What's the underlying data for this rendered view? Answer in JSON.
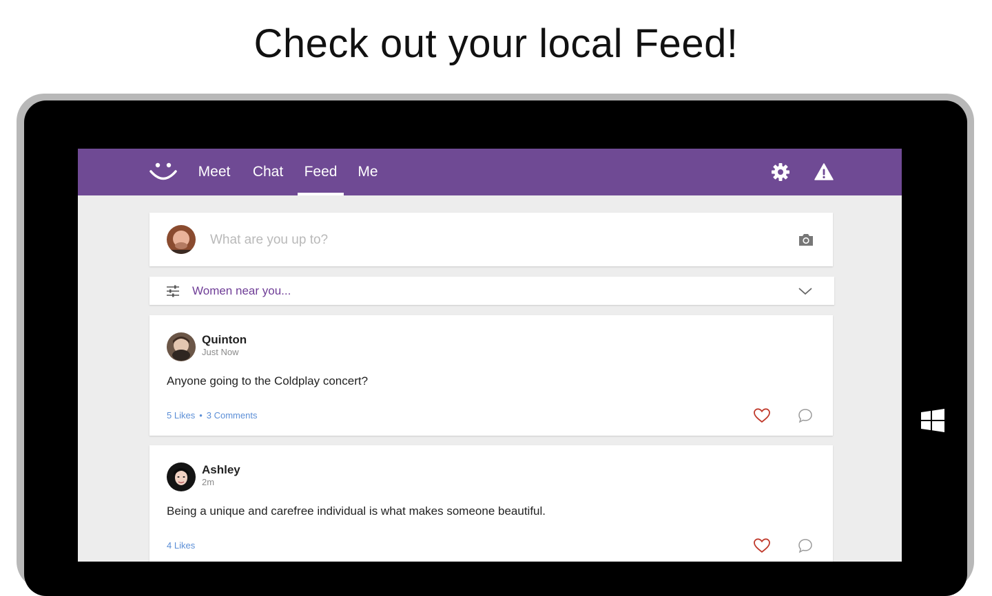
{
  "promo": {
    "headline": "Check out your local Feed!"
  },
  "colors": {
    "brand": "#6f4a94",
    "filter_text": "#6f3d97",
    "link": "#5b8ed6",
    "like_heart": "#c0392b"
  },
  "header": {
    "logo_icon": "smiley-icon",
    "tabs": [
      {
        "label": "Meet"
      },
      {
        "label": "Chat"
      },
      {
        "label": "Feed",
        "active": true
      },
      {
        "label": "Me"
      }
    ],
    "icons": [
      "gear-icon",
      "warning-icon"
    ]
  },
  "composer": {
    "placeholder": "What are you up to?",
    "icon": "camera-icon"
  },
  "filter": {
    "label": "Women near you...",
    "icon": "sliders-icon",
    "expand_icon": "chevron-down-icon"
  },
  "posts": [
    {
      "author": "Quinton",
      "time": "Just Now",
      "text": "Anyone going to the Coldplay concert?",
      "likes": "5 Likes",
      "comments": "3 Comments"
    },
    {
      "author": "Ashley",
      "time": "2m",
      "text": "Being a unique and carefree individual is what makes someone beautiful.",
      "likes": "4 Likes"
    }
  ]
}
